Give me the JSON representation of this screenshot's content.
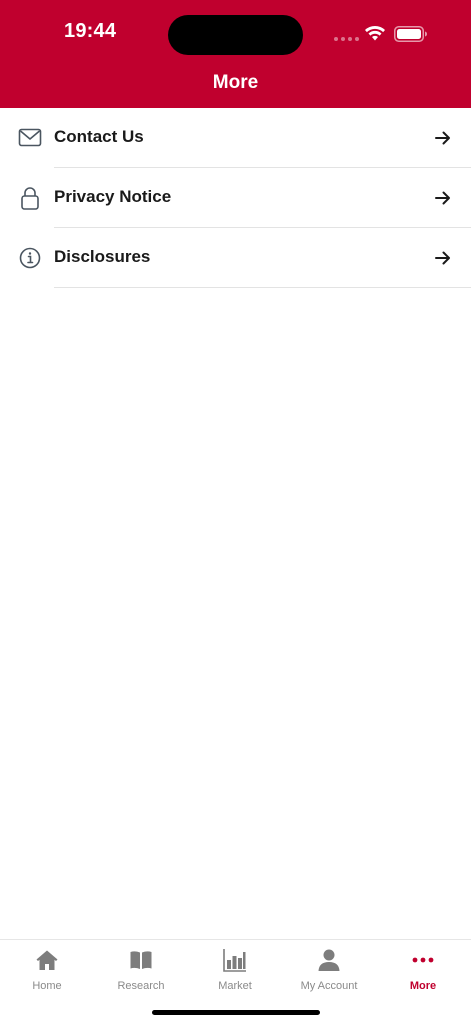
{
  "status_bar": {
    "time": "19:44"
  },
  "header": {
    "title": "More",
    "background_color": "#c0002e"
  },
  "menu": {
    "items": [
      {
        "label": "Contact Us",
        "icon": "mail-icon"
      },
      {
        "label": "Privacy Notice",
        "icon": "lock-icon"
      },
      {
        "label": "Disclosures",
        "icon": "info-icon"
      }
    ]
  },
  "tab_bar": {
    "tabs": [
      {
        "label": "Home",
        "icon": "home-icon",
        "active": false
      },
      {
        "label": "Research",
        "icon": "book-icon",
        "active": false
      },
      {
        "label": "Market",
        "icon": "bar-chart-icon",
        "active": false
      },
      {
        "label": "My Account",
        "icon": "person-icon",
        "active": false
      },
      {
        "label": "More",
        "icon": "more-dots-icon",
        "active": true
      }
    ],
    "active_color": "#c0002e",
    "inactive_color": "#8a8a8a"
  }
}
